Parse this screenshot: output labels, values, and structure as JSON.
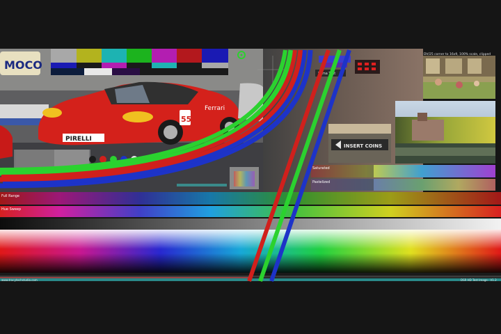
{
  "labels": {
    "luma_test": "Luma Test",
    "saturated": "Saturated",
    "pastelized": "Pastelized",
    "full_range": "Full Range",
    "hue_sweep": "Hue Sweep",
    "top_right_caption": "DV/25 corner to 16x9, 100% scale, clipped",
    "bottom_left_caption": "www.tracytechstudio.com",
    "bottom_right_caption": "DSR HD Test Image · V1.2"
  },
  "car": {
    "number": "55",
    "sponsor": "PIRELLI",
    "sponsor_side": "Ferrari"
  },
  "sign": {
    "text": "INSERT COINS"
  },
  "colors": {
    "background": "#151515",
    "red": "#d0201c",
    "green": "#2bd22f",
    "blue": "#1d33c8",
    "car_red": "#d4211b"
  }
}
